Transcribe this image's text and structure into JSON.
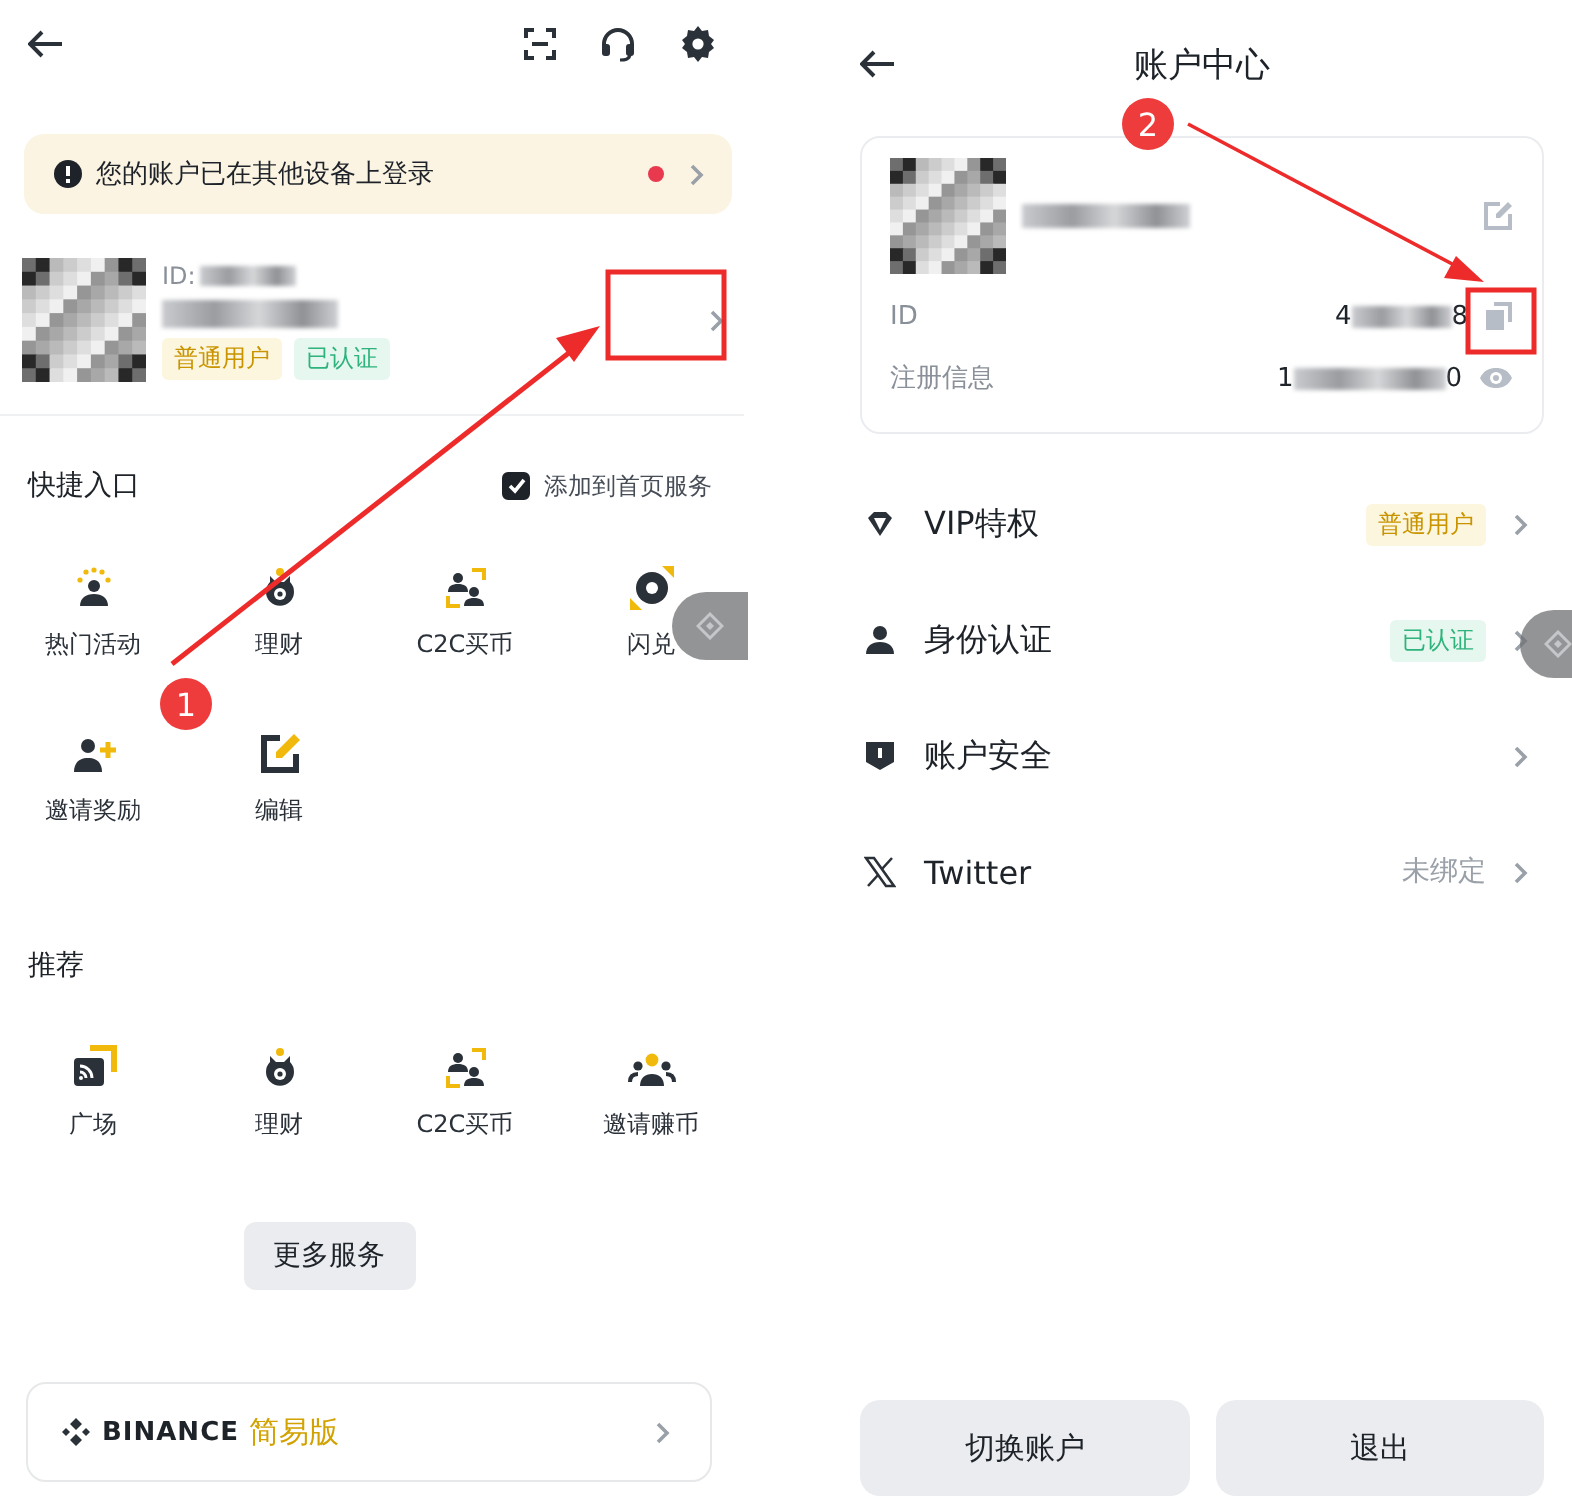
{
  "left_screen": {
    "notice": {
      "text": "您的账户已在其他设备上登录",
      "unread": true
    },
    "profile": {
      "id_label": "ID:",
      "badges": [
        {
          "label": "普通用户",
          "kind": "level"
        },
        {
          "label": "已认证",
          "kind": "verified"
        }
      ]
    },
    "quick_access": {
      "title": "快捷入口",
      "add_to_home": {
        "label": "添加到首页服务",
        "checked": true
      },
      "items": [
        {
          "label": "热门活动",
          "kind": "activity"
        },
        {
          "label": "理财",
          "kind": "finance"
        },
        {
          "label": "C2C买币",
          "kind": "c2c"
        },
        {
          "label": "闪兑",
          "kind": "swap"
        },
        {
          "label": "邀请奖励",
          "kind": "invite"
        },
        {
          "label": "编辑",
          "kind": "edit"
        }
      ]
    },
    "recommended": {
      "title": "推荐",
      "items": [
        {
          "label": "广场",
          "kind": "square"
        },
        {
          "label": "理财",
          "kind": "finance"
        },
        {
          "label": "C2C买币",
          "kind": "c2c"
        },
        {
          "label": "邀请赚币",
          "kind": "group"
        }
      ]
    },
    "more_button": "更多服务",
    "simple_banner": {
      "brand": "BINANCE",
      "label": "简易版"
    }
  },
  "right_screen": {
    "title": "账户中心",
    "account_card": {
      "id_label": "ID",
      "id_start": "4",
      "id_end": "8",
      "registration_label": "注册信息",
      "registration_start": "1",
      "registration_end": "0"
    },
    "menu": [
      {
        "label": "VIP特权",
        "kind": "vip",
        "badge": {
          "label": "普通用户",
          "kind": "level"
        }
      },
      {
        "label": "身份认证",
        "kind": "identity",
        "badge": {
          "label": "已认证",
          "kind": "verified"
        }
      },
      {
        "label": "账户安全",
        "kind": "security"
      },
      {
        "label": "Twitter",
        "kind": "twitter",
        "value": "未绑定"
      }
    ],
    "buttons": [
      "切换账户",
      "退出"
    ]
  },
  "annotations": [
    {
      "number": "1"
    },
    {
      "number": "2"
    }
  ]
}
